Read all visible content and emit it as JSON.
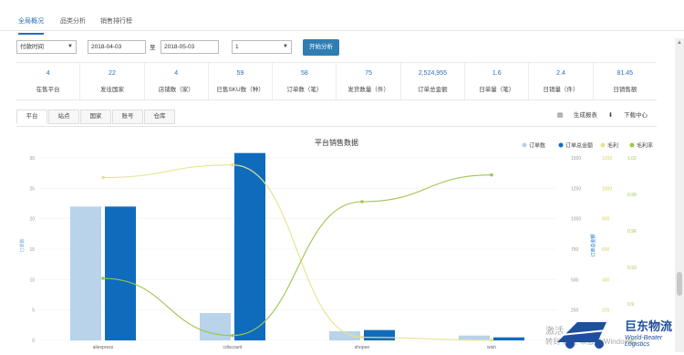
{
  "top_tabs": [
    {
      "label": "全局概况",
      "active": true
    },
    {
      "label": "品类分析",
      "active": false
    },
    {
      "label": "销售排行榜",
      "active": false
    }
  ],
  "filters": {
    "time_type": "付款时间",
    "start_date": "2018-04-03",
    "to_label": "至",
    "end_date": "2018-05-03",
    "count_select": "1",
    "start_button": "开始分析"
  },
  "stats": [
    {
      "value": "4",
      "label": "在售平台"
    },
    {
      "value": "22",
      "label": "发往国家"
    },
    {
      "value": "4",
      "label": "店铺数（家）"
    },
    {
      "value": "59",
      "label": "已售SKU数（种）"
    },
    {
      "value": "58",
      "label": "订单数（笔）"
    },
    {
      "value": "75",
      "label": "发货数量（件）"
    },
    {
      "value": "2,524,955",
      "label": "订单总金额"
    },
    {
      "value": "1.6",
      "label": "日单量（笔）"
    },
    {
      "value": "2.4",
      "label": "日销量（件）"
    },
    {
      "value": "81.45",
      "label": "日销售额"
    }
  ],
  "sub_tabs": [
    {
      "label": "平台",
      "active": true
    },
    {
      "label": "站点",
      "active": false
    },
    {
      "label": "国家",
      "active": false
    },
    {
      "label": "账号",
      "active": false
    },
    {
      "label": "仓库",
      "active": false
    }
  ],
  "actions": {
    "generate_report": "生成报表",
    "download": "下载中心"
  },
  "chart_data": {
    "type": "bar",
    "title": "平台销售数据",
    "categories": [
      "aliexpress",
      "cdiscount",
      "shopee",
      "wish"
    ],
    "ylabel_left": "订单数",
    "ylabel_right1": "订单总金额",
    "left_axis_ticks": [
      "0",
      "5",
      "10",
      "15",
      "20",
      "25",
      "30"
    ],
    "right_axis_ticks": [
      "0",
      "250",
      "500",
      "750",
      "1000",
      "1250",
      "1500"
    ],
    "right2_ticks": [
      "0",
      "200",
      "400",
      "600",
      "800",
      "1000",
      "1200"
    ],
    "right3_ticks": [
      "0.87",
      "0.9",
      "0.93",
      "0.96",
      "0.99",
      "1.02"
    ],
    "series": [
      {
        "name": "订单数",
        "color": "#b8d3ea",
        "values": [
          22,
          4.5,
          1.5,
          0.8
        ]
      },
      {
        "name": "订单总金额",
        "color": "#0f6cbd",
        "values": [
          1100,
          1540,
          85,
          25
        ]
      },
      {
        "name": "毛利",
        "color": "#e6e38a",
        "values": [
          1290,
          1390,
          25,
          2
        ]
      },
      {
        "name": "毛利率",
        "color": "#9ec54f",
        "values": [
          0.921,
          0.874,
          0.984,
          1.006
        ]
      }
    ],
    "ylim_left": [
      0,
      30
    ],
    "ylim_right": [
      0,
      1500
    ],
    "legend_position": "top-right"
  },
  "watermark": {
    "line1": "激活",
    "line2": "转到\"设置\"以激活 Windows。"
  },
  "logo": {
    "cn": "巨东物流",
    "en": "World-Beater Logistics"
  }
}
